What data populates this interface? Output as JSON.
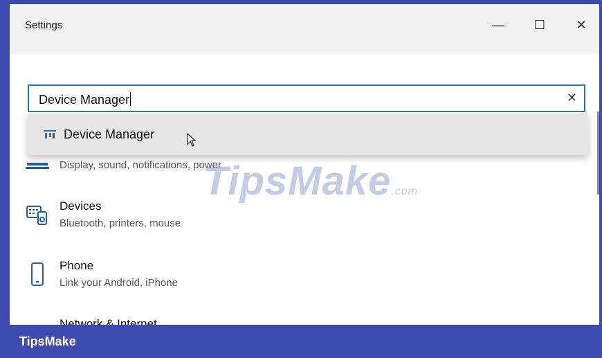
{
  "window": {
    "title": "Settings",
    "controls": {
      "minimize": "—",
      "maximize": "☐",
      "close": "✕"
    }
  },
  "search": {
    "value": "Device Manager",
    "clear_icon": "✕"
  },
  "dropdown": {
    "result_label": "Device Manager",
    "icon": "device-manager-icon"
  },
  "items": [
    {
      "title": "",
      "subtitle": "Display, sound, notifications, power",
      "icon": "system-icon"
    },
    {
      "title": "Devices",
      "subtitle": "Bluetooth, printers, mouse",
      "icon": "devices-icon"
    },
    {
      "title": "Phone",
      "subtitle": "Link your Android, iPhone",
      "icon": "phone-icon"
    },
    {
      "title": "Network & Internet",
      "subtitle": "",
      "icon": "network-icon"
    }
  ],
  "watermark": {
    "main": "TipsMake",
    "suffix": ".com"
  },
  "footer": {
    "brand": "TipsMake"
  },
  "colors": {
    "accent": "#2a76c6",
    "banner": "#3f4ab0"
  }
}
